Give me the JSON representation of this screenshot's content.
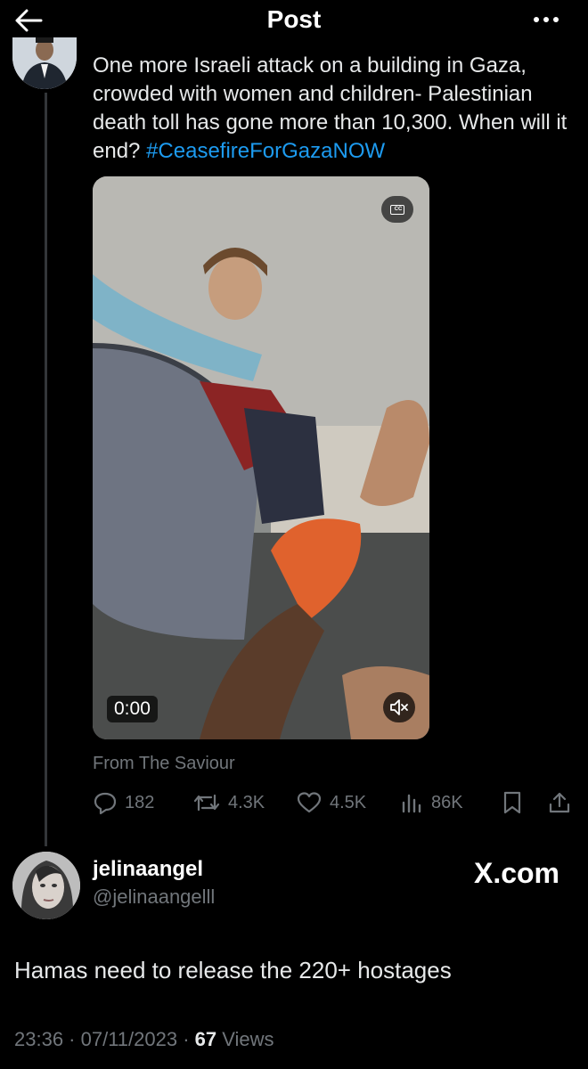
{
  "header": {
    "title": "Post",
    "back_icon": "arrow-left-icon",
    "more_icon": "ellipsis-icon"
  },
  "quoted_post": {
    "text": "One more Israeli attack on a building in Gaza, crowded with women and children- Palestinian death toll has gone more than 10,300. When will it end? ",
    "hashtag": "#CeasefireForGazaNOW",
    "video": {
      "cc_label": "CC",
      "time": "0:00",
      "mute_icon": "speaker-muted-icon"
    },
    "from_label": "From The Saviour",
    "stats": {
      "replies": "182",
      "reposts": "4.3K",
      "likes": "4.5K",
      "views": "86K"
    }
  },
  "reply": {
    "name": "jelinaangel",
    "handle": "@jelinaangelll",
    "watermark": "X.com",
    "text": "Hamas need to release the 220+ hostages",
    "timestamp": "23:36 · 07/11/2023 · ",
    "views_count": "67",
    "views_label": " Views"
  },
  "colors": {
    "background": "#000000",
    "link": "#1d9bf0",
    "muted": "#71767b",
    "text": "#e7e9ea"
  }
}
